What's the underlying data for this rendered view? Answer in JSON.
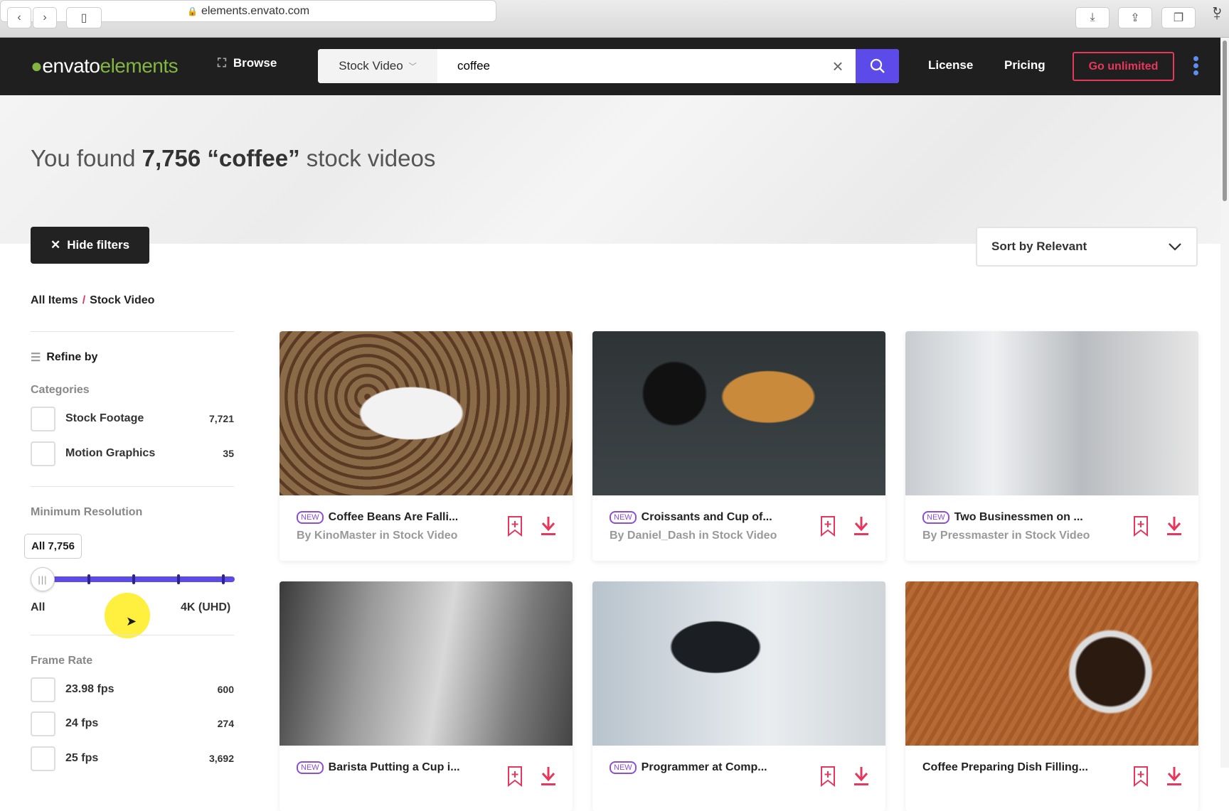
{
  "browser": {
    "url": "elements.envato.com"
  },
  "nav": {
    "logo_a": "envato",
    "logo_b": "elements",
    "browse": "Browse",
    "category": "Stock Video",
    "query": "coffee",
    "license": "License",
    "pricing": "Pricing",
    "go_unlimited": "Go unlimited"
  },
  "hero": {
    "prefix": "You found ",
    "count": "7,756",
    "query": "“coffee”",
    "suffix": " stock videos"
  },
  "hide_filters": "Hide filters",
  "sort": "Sort by Relevant",
  "breadcrumb": {
    "root": "All Items",
    "sep": "/",
    "current": "Stock Video"
  },
  "sidebar": {
    "refine": "Refine by",
    "categories_title": "Categories",
    "categories": [
      {
        "label": "Stock Footage",
        "count": "7,721"
      },
      {
        "label": "Motion Graphics",
        "count": "35"
      }
    ],
    "resolution_title": "Minimum Resolution",
    "resolution_tooltip": "All 7,756",
    "resolution_min": "All",
    "resolution_max": "4K (UHD)",
    "resolution_value": 0,
    "framerate_title": "Frame Rate",
    "framerates": [
      {
        "label": "23.98 fps",
        "count": "600"
      },
      {
        "label": "24 fps",
        "count": "274"
      },
      {
        "label": "25 fps",
        "count": "3,692"
      }
    ]
  },
  "badge_new": "NEW",
  "cards": [
    {
      "title": "Coffee Beans Are Falli...",
      "author": "By KinoMaster in Stock Video",
      "new": true
    },
    {
      "title": "Croissants and Cup of...",
      "author": "By Daniel_Dash in Stock Video",
      "new": true
    },
    {
      "title": "Two Businessmen on ...",
      "author": "By Pressmaster in Stock Video",
      "new": true
    },
    {
      "title": "Barista Putting a Cup i...",
      "author": "",
      "new": true
    },
    {
      "title": "Programmer at Comp...",
      "author": "",
      "new": true
    },
    {
      "title": "Coffee Preparing Dish Filling...",
      "author": "",
      "new": false
    }
  ],
  "colors": {
    "accent": "#5c4be8",
    "brand_green": "#82b541",
    "pink": "#e5385c",
    "nav_bg": "#1f1f1f"
  }
}
